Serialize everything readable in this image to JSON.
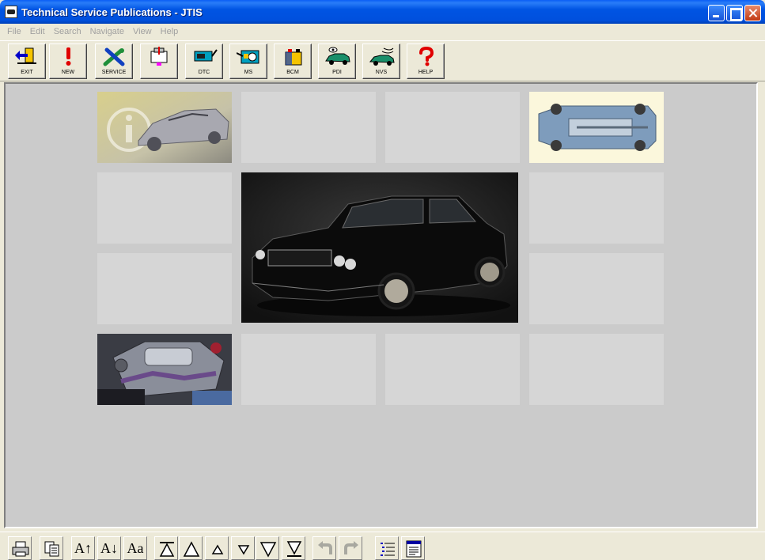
{
  "window": {
    "title": "Technical Service Publications - JTIS"
  },
  "menu": {
    "items": [
      "File",
      "Edit",
      "Search",
      "Navigate",
      "View",
      "Help"
    ]
  },
  "toolbar": {
    "buttons": [
      {
        "label": "EXIT",
        "icon": "exit-door-icon"
      },
      {
        "label": "NEW",
        "icon": "exclamation-icon"
      },
      {
        "label": "SERVICE",
        "icon": "wrench-icon"
      },
      {
        "label": "",
        "icon": "engine-diagnostic-icon"
      },
      {
        "label": "DTC",
        "icon": "dtc-tester-icon"
      },
      {
        "label": "MS",
        "icon": "oscilloscope-icon"
      },
      {
        "label": "BCM",
        "icon": "battery-icon"
      },
      {
        "label": "PDI",
        "icon": "car-inspection-icon"
      },
      {
        "label": "NVS",
        "icon": "car-sound-icon"
      },
      {
        "label": "HELP",
        "icon": "question-mark-icon"
      }
    ]
  },
  "bottom_toolbar": {
    "buttons": [
      {
        "icon": "print-icon"
      },
      {
        "icon": "copy-icon"
      },
      {
        "text": "A↑",
        "icon": "font-increase-icon"
      },
      {
        "text": "A↓",
        "icon": "font-decrease-icon"
      },
      {
        "text": "Aa",
        "icon": "font-toggle-icon"
      },
      {
        "icon": "first-page-icon"
      },
      {
        "icon": "previous-section-icon"
      },
      {
        "icon": "previous-page-icon"
      },
      {
        "icon": "next-page-icon"
      },
      {
        "icon": "next-section-icon"
      },
      {
        "icon": "last-page-icon"
      },
      {
        "icon": "undo-icon"
      },
      {
        "icon": "redo-icon"
      },
      {
        "icon": "contents-list-icon"
      },
      {
        "icon": "document-icon"
      }
    ]
  },
  "colors": {
    "titlebar": "#0054e3",
    "content_bg": "#cbcbcb",
    "tile_bg": "#d6d6d6",
    "toolbar_bg": "#ece9d8"
  }
}
